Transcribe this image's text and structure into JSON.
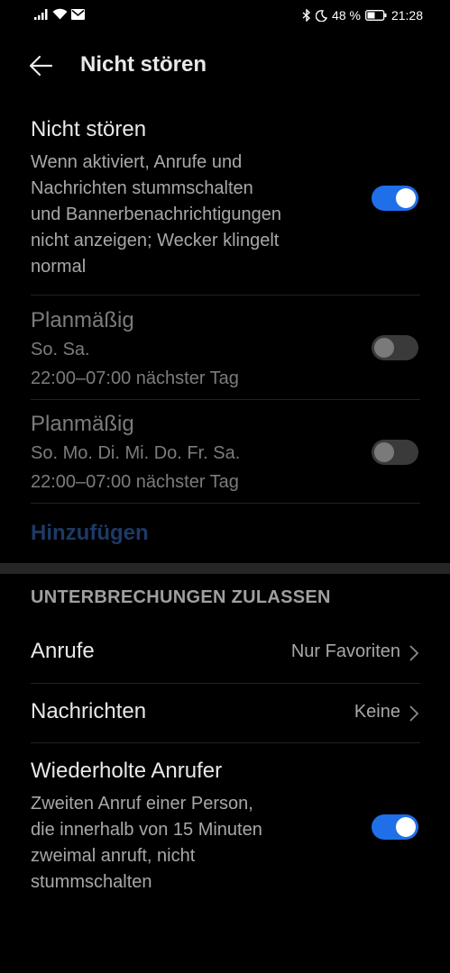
{
  "statusbar": {
    "battery": "48 %",
    "time": "21:28"
  },
  "appbar": {
    "title": "Nicht stören"
  },
  "dnd": {
    "title": "Nicht stören",
    "description_lines": [
      "Wenn aktiviert, Anrufe und",
      "Nachrichten stummschalten",
      "und Bannerbenachrichtigungen",
      "nicht anzeigen; Wecker klingelt",
      "normal"
    ],
    "enabled": true
  },
  "schedules": [
    {
      "title": "Planmäßig",
      "days": "So. Sa.",
      "time": "22:00–07:00 nächster Tag",
      "enabled": false
    },
    {
      "title": "Planmäßig",
      "days": "So. Mo. Di. Mi. Do. Fr. Sa.",
      "time": "22:00–07:00 nächster Tag",
      "enabled": false
    }
  ],
  "add_label": "Hinzufügen",
  "interruptions": {
    "header": "UNTERBRECHUNGEN ZULASSEN",
    "calls": {
      "title": "Anrufe",
      "value": "Nur Favoriten"
    },
    "messages": {
      "title": "Nachrichten",
      "value": "Keine"
    },
    "repeat": {
      "title": "Wiederholte Anrufer",
      "description_lines": [
        "Zweiten Anruf einer Person,",
        "die innerhalb von 15 Minuten",
        "zweimal anruft, nicht",
        "stummschalten"
      ],
      "enabled": true
    }
  },
  "colors": {
    "accent": "#1f6fe8",
    "background": "#000000",
    "add_link": "#1d3a66"
  }
}
